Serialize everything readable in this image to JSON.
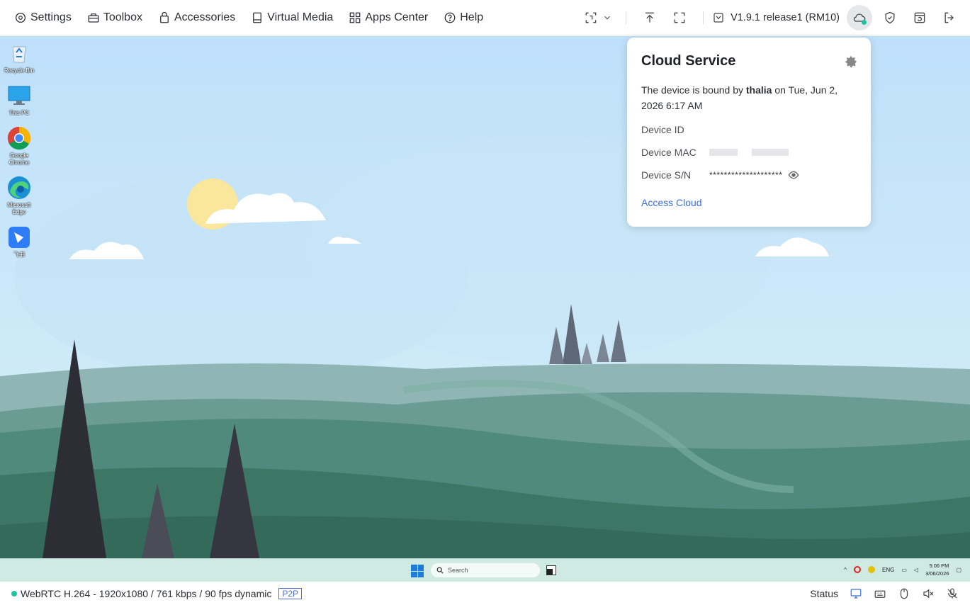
{
  "topbar": {
    "menu": [
      {
        "label": "Settings",
        "icon": "gear-icon"
      },
      {
        "label": "Toolbox",
        "icon": "toolbox-icon"
      },
      {
        "label": "Accessories",
        "icon": "lock-bag-icon"
      },
      {
        "label": "Virtual Media",
        "icon": "drive-icon"
      },
      {
        "label": "Apps Center",
        "icon": "apps-grid-icon"
      },
      {
        "label": "Help",
        "icon": "help-circle-icon"
      }
    ],
    "version": "V1.9.1 release1 (RM10)",
    "cloud_status_color": "#1cc3a2"
  },
  "desktop": {
    "icons": [
      {
        "label": "Recycle Bin",
        "icon": "recycle-bin-icon"
      },
      {
        "label": "This PC",
        "icon": "monitor-icon"
      },
      {
        "label": "Google Chrome",
        "icon": "chrome-icon"
      },
      {
        "label": "Microsoft Edge",
        "icon": "edge-icon"
      },
      {
        "label": "飞书",
        "icon": "app-shortcut-icon"
      }
    ]
  },
  "taskbar": {
    "search_placeholder": "Search",
    "lang": "ENG",
    "time": "5:06 PM",
    "date": "3/06/2026"
  },
  "popup": {
    "title": "Cloud Service",
    "bound_prefix": "The device is bound by ",
    "bound_user": "thalia",
    "bound_suffix": " on Tue, Jun 2, 2026 6:17 AM",
    "device_id_label": "Device ID",
    "device_mac_label": "Device MAC",
    "device_sn_label": "Device S/N",
    "device_sn_value": "********************",
    "access_link": "Access Cloud"
  },
  "statusbar": {
    "stream_info": "WebRTC H.264 - 1920x1080 / 761 kbps / 90 fps dynamic",
    "p2p": "P2P",
    "status_label": "Status"
  }
}
